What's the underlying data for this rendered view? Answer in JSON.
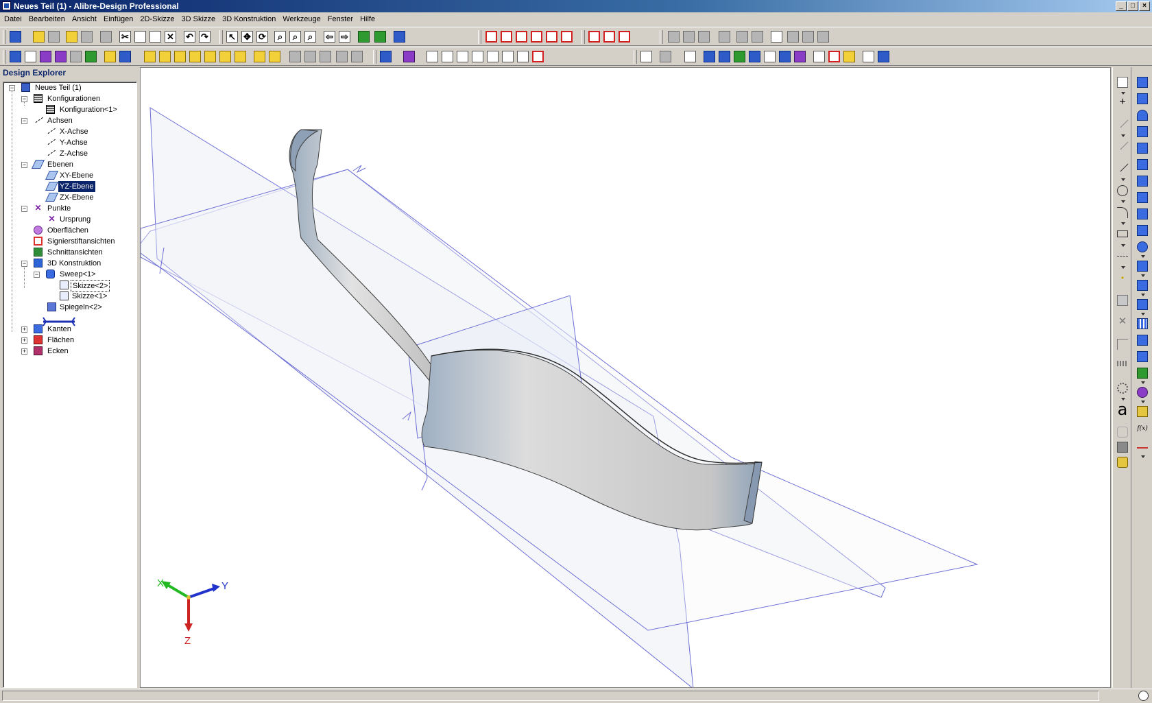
{
  "window": {
    "title": "Neues Teil (1) - Alibre-Design Professional"
  },
  "menu": [
    "Datei",
    "Bearbeiten",
    "Ansicht",
    "Einfügen",
    "2D-Skizze",
    "3D Skizze",
    "3D Konstruktion",
    "Werkzeuge",
    "Fenster",
    "Hilfe"
  ],
  "explorer": {
    "header": "Design Explorer",
    "root": "Neues Teil (1)",
    "konfigurationen": "Konfigurationen",
    "konfiguration1": "Konfiguration<1>",
    "achsen": "Achsen",
    "x_achse": "X-Achse",
    "y_achse": "Y-Achse",
    "z_achse": "Z-Achse",
    "ebenen": "Ebenen",
    "xy_ebene": "XY-Ebene",
    "yz_ebene": "YZ-Ebene",
    "zx_ebene": "ZX-Ebene",
    "punkte": "Punkte",
    "ursprung": "Ursprung",
    "oberflaechen": "Oberflächen",
    "signierstift": "Signierstiftansichten",
    "schnitt": "Schnittansichten",
    "konstruktion": "3D Konstruktion",
    "sweep": "Sweep<1>",
    "skizze2": "Skizze<2>",
    "skizze1": "Skizze<1>",
    "spiegeln": "Spiegeln<2>",
    "kanten": "Kanten",
    "flaechen": "Flächen",
    "ecken": "Ecken"
  },
  "viewport": {
    "triad": {
      "x": "X",
      "y": "Y",
      "z": "Z"
    },
    "colors": {
      "plane_edge": "#6d6fd6",
      "x_axis": "#22b822",
      "y_axis": "#2233cc",
      "z_axis": "#cc2222"
    }
  },
  "palette": {
    "a_glyph": "a",
    "fx_glyph": "f(x)"
  },
  "status": {
    "text": ""
  }
}
